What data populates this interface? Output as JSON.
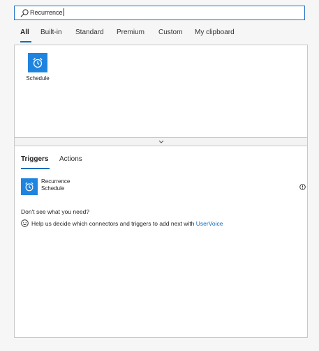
{
  "search": {
    "value": "Recurrence"
  },
  "tabs": [
    {
      "label": "All"
    },
    {
      "label": "Built-in"
    },
    {
      "label": "Standard"
    },
    {
      "label": "Premium"
    },
    {
      "label": "Custom"
    },
    {
      "label": "My clipboard"
    }
  ],
  "connectors": [
    {
      "label": "Schedule",
      "icon": "alarm-clock-icon"
    }
  ],
  "subtabs": [
    {
      "label": "Triggers"
    },
    {
      "label": "Actions"
    }
  ],
  "trigger": {
    "name": "Recurrence",
    "connector": "Schedule",
    "icon": "alarm-clock-icon"
  },
  "help": {
    "question": "Don't see what you need?",
    "text": "Help us decide which connectors and triggers to add next with ",
    "link": "UserVoice"
  },
  "colors": {
    "accent": "#0f6cbd",
    "icon_bg": "#1f84e0"
  }
}
